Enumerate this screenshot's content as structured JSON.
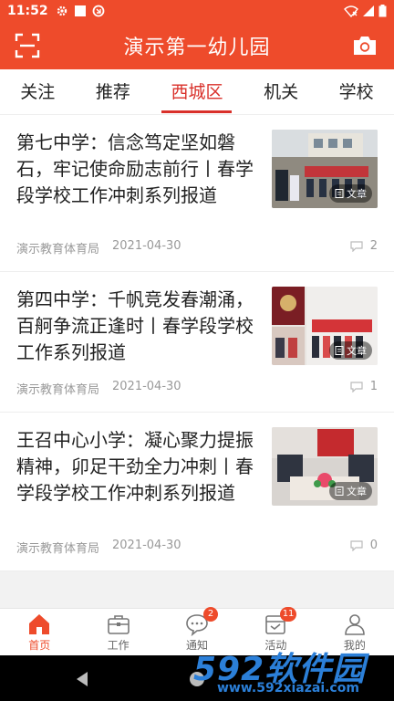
{
  "status_bar": {
    "time": "11:52"
  },
  "header": {
    "title": "演示第一幼儿园"
  },
  "tabs": [
    {
      "label": "关注"
    },
    {
      "label": "推荐"
    },
    {
      "label": "西城区"
    },
    {
      "label": "机关"
    },
    {
      "label": "学校"
    }
  ],
  "active_tab": "西城区",
  "news": [
    {
      "title": "第七中学：信念笃定坚如磐石，牢记使命励志前行丨春学段学校工作冲刺系列报道",
      "source": "演示教育体育局",
      "date": "2021-04-30",
      "comments": "2",
      "badge": "文章"
    },
    {
      "title": "第四中学：千帆竞发春潮涌，百舸争流正逢时丨春学段学校工作系列报道",
      "source": "演示教育体育局",
      "date": "2021-04-30",
      "comments": "1",
      "badge": "文章"
    },
    {
      "title": "王召中心小学：凝心聚力提振精神，卯足干劲全力冲刺丨春学段学校工作冲刺系列报道",
      "source": "演示教育体育局",
      "date": "2021-04-30",
      "comments": "0",
      "badge": "文章"
    }
  ],
  "bottom_nav": [
    {
      "label": "首页",
      "badge": ""
    },
    {
      "label": "工作",
      "badge": ""
    },
    {
      "label": "通知",
      "badge": "2"
    },
    {
      "label": "活动",
      "badge": "11"
    },
    {
      "label": "我的",
      "badge": ""
    }
  ],
  "watermark": {
    "logo": "592软件园",
    "url": "www.592xiazai.com"
  },
  "colors": {
    "brand": "#ee4b2b",
    "active_tab": "#d9302a",
    "watermark": "#2b7fd8"
  }
}
